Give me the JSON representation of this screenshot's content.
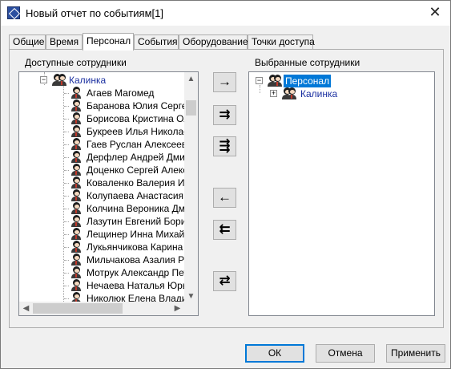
{
  "window": {
    "title": "Новый отчет по событиям[1]",
    "app_icon": "report-app-icon",
    "close_glyph": "✕"
  },
  "tabs": [
    {
      "label": "Общие"
    },
    {
      "label": "Время"
    },
    {
      "label": "Персонал",
      "active": true
    },
    {
      "label": "События"
    },
    {
      "label": "Оборудование"
    },
    {
      "label": "Точки доступа"
    }
  ],
  "available": {
    "label": "Доступные сотрудники",
    "group": "Калинка",
    "employees": [
      "Агаев Магомед",
      "Баранова Юлия Сергеевна",
      "Борисова Кристина Олеговна",
      "Букреев Илья Николаевич",
      "Гаев Руслан Алексеевич",
      "Дерфлер Андрей Дмитриевич",
      "Доценко Сергей Александрович",
      "Коваленко Валерия Игоревна",
      "Колупаева Анастасия",
      "Колчина Вероника Дмитриевна",
      "Лазутин Евгений Борисович",
      "Лещинер Инна Михайловна",
      "Лукьянчикова Карина Павловна",
      "Мильчакова Азалия Ратмировна",
      "Мотрук Александр Петрович",
      "Нечаева Наталья Юрьевна",
      "Николюк Елена Владимировна"
    ]
  },
  "selected": {
    "label": "Выбранные сотрудники",
    "root": "Персонал",
    "child": "Калинка"
  },
  "move_buttons": [
    {
      "name": "add-selected-button",
      "glyph": "→"
    },
    {
      "name": "add-all-button",
      "glyph": "⇉"
    },
    {
      "name": "add-group-button",
      "glyph": "⇶"
    },
    {
      "name": "remove-selected-button",
      "glyph": "←"
    },
    {
      "name": "remove-all-button",
      "glyph": "⇇"
    },
    {
      "name": "swap-button",
      "glyph": "⇄"
    }
  ],
  "footer": {
    "ok": "ОК",
    "cancel": "Отмена",
    "apply": "Применить"
  },
  "scrollbars": {
    "up": "▲",
    "down": "▼",
    "left": "◀",
    "right": "▶"
  }
}
